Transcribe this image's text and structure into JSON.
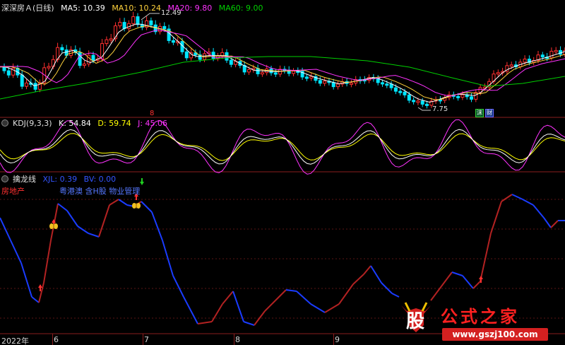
{
  "main": {
    "title": "深深房Ａ(日线)",
    "ma5": "MA5: 10.39",
    "ma10": "MA10: 10.24",
    "ma20": "MA20: 9.80",
    "ma60": "MA60: 9.00",
    "high_label": "12.49",
    "low_label": "7.75",
    "badge_1": "沫",
    "badge_2": "财",
    "marker": "8",
    "colors": {
      "ma5": "#ffffff",
      "ma10": "#ffd23c",
      "ma20": "#ff33ff",
      "ma60": "#00d000"
    }
  },
  "kdj": {
    "name": "KDJ(9,3,3)",
    "k": "K: 54.84",
    "d": "D: 59.74",
    "j": "J: 45.06",
    "colors": {
      "k": "#ffffff",
      "d": "#ffff00",
      "j": "#ff33ff"
    }
  },
  "dragon": {
    "name": "擒龙线",
    "xjl": "XJL: 0.39",
    "bv": "BV: 0.00",
    "sector": "房地产",
    "concepts": "粤港澳 含H股 物业管理",
    "colors": {
      "down": "#1a3cff",
      "up": "#b22222"
    }
  },
  "xaxis": {
    "labels": [
      "2022年",
      "6",
      "7",
      "8",
      "9"
    ]
  },
  "watermark": {
    "logo": "股",
    "brand": "公式之家",
    "url": "www.gszj100.com"
  }
}
